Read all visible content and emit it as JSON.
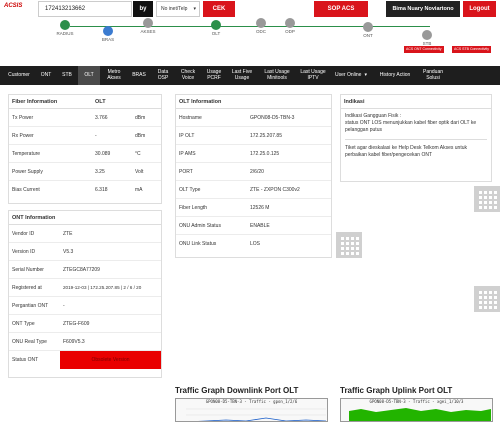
{
  "app": {
    "logo": "ACSIS"
  },
  "search": {
    "value": "172413213662",
    "by_label": "by",
    "mode": "No inet/Telp",
    "check_label": "CEK"
  },
  "header": {
    "sop_label": "SOP ACS",
    "user_name": "Bima Nuary Noviartono",
    "logout_label": "Logout"
  },
  "topology": {
    "nodes": [
      "RADIUS",
      "BRAS",
      "AKSES",
      "OLT",
      "ODC",
      "ODP",
      "ONT",
      "STB"
    ],
    "acs_ont": "ACS ONT Connectivity",
    "acs_stb": "ACS STB Connectivity"
  },
  "nav": {
    "items": [
      "Customer",
      "ONT",
      "STB",
      "OLT",
      "Metro Akses",
      "BRAS",
      "Data OSP",
      "Check Voice",
      "Usage PCRF",
      "Last Five Usage",
      "Last Usage Minitools",
      "Last Usage IPTV",
      "User Online",
      "History Action",
      "Panduan Solusi"
    ],
    "active": "OLT"
  },
  "fiber": {
    "title": "Fiber Information",
    "col": "OLT",
    "rows": [
      {
        "k": "Tx Power",
        "v": "3.766",
        "u": "dBm"
      },
      {
        "k": "Rx Power",
        "v": "-",
        "u": "dBm"
      },
      {
        "k": "Temperature",
        "v": "30.089",
        "u": "°C"
      },
      {
        "k": "Power Supply",
        "v": "3.25",
        "u": "Volt"
      },
      {
        "k": "Bias Current",
        "v": "6.318",
        "u": "mA"
      }
    ]
  },
  "ont": {
    "title": "ONT Information",
    "rows": [
      {
        "k": "Vendor ID",
        "v": "ZTE"
      },
      {
        "k": "Version ID",
        "v": "V5.3"
      },
      {
        "k": "Serial Number",
        "v": "ZTEGC8A77209"
      },
      {
        "k": "Registered at",
        "v": "2019-12-03 | 172.25.207.85 | 2 / 6 / 20"
      },
      {
        "k": "Pergantian ONT",
        "v": "-"
      },
      {
        "k": "ONT Type",
        "v": "ZTEG-F609"
      },
      {
        "k": "ONU Real Type",
        "v": "F609V5.3"
      },
      {
        "k": "Status ONT",
        "v": "Obsolete Version"
      }
    ]
  },
  "olt": {
    "title": "OLT Information",
    "rows": [
      {
        "k": "Hostname",
        "v": "GPON08-D5-TBN-3"
      },
      {
        "k": "IP OLT",
        "v": "172.25.207.85"
      },
      {
        "k": "IP AMS",
        "v": "172.25.0.125"
      },
      {
        "k": "PORT",
        "v": "2/6/20"
      },
      {
        "k": "OLT Type",
        "v": "ZTE - ZXPON C300v2"
      },
      {
        "k": "Fiber Length",
        "v": "12526 M"
      },
      {
        "k": "ONU Admin Status",
        "v": "ENABLE"
      },
      {
        "k": "ONU Link Status",
        "v": "LOS"
      }
    ]
  },
  "indikasi": {
    "title": "Indikasi",
    "text1": "Indikasi Gangguan Fisik :",
    "text2": "status ONT LOS menunjukkan kabel fiber optik dari OLT ke pelanggan putus",
    "text3": "Tiket agar dieskalasi ke Help Desk Telkom Akses untuk perbaikan kabel fiber/pengecekan ONT"
  },
  "graphs": {
    "downlink_title": "Traffic Graph Downlink Port OLT",
    "uplink_title": "Traffic Graph Uplink Port OLT",
    "downlink_caption": "GPON08-D5-TBN-3 - Traffic - gpon_1/2/6",
    "uplink_caption": "GPON08-D5-TBN-3 - Traffic - xgei_1/10/3"
  },
  "colors": {
    "accent": "#d9141b",
    "nav_bg": "#1e1e1e",
    "topo_line": "#2c8f4a",
    "status_bad": "#e90000"
  }
}
